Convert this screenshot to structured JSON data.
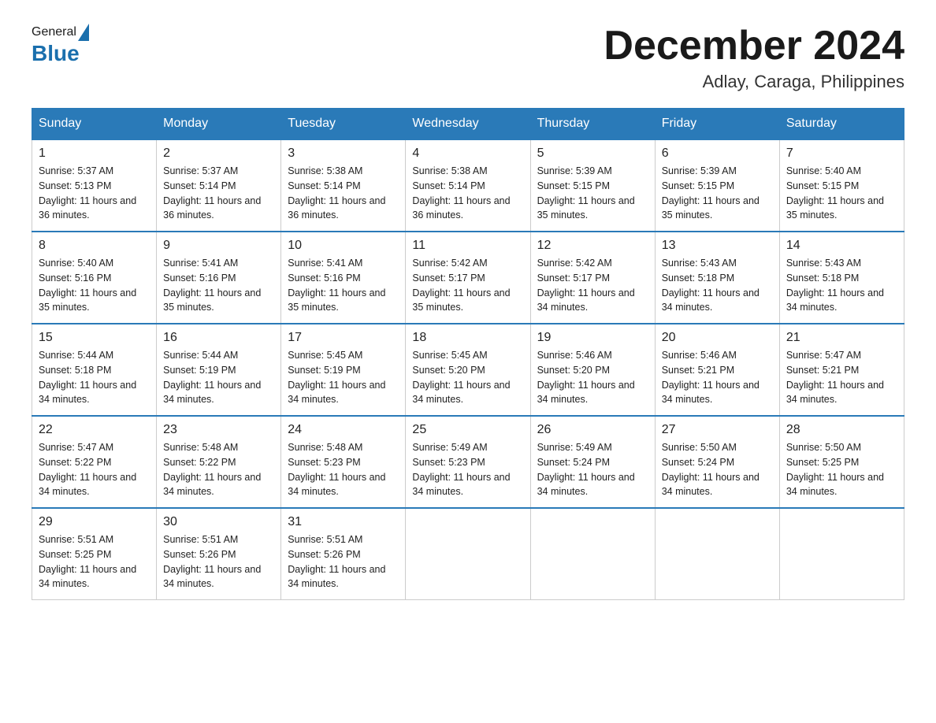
{
  "header": {
    "logo_general": "General",
    "logo_blue": "Blue",
    "month_title": "December 2024",
    "location": "Adlay, Caraga, Philippines"
  },
  "days_of_week": [
    "Sunday",
    "Monday",
    "Tuesday",
    "Wednesday",
    "Thursday",
    "Friday",
    "Saturday"
  ],
  "weeks": [
    [
      {
        "day": "1",
        "sunrise": "5:37 AM",
        "sunset": "5:13 PM",
        "daylight": "11 hours and 36 minutes."
      },
      {
        "day": "2",
        "sunrise": "5:37 AM",
        "sunset": "5:14 PM",
        "daylight": "11 hours and 36 minutes."
      },
      {
        "day": "3",
        "sunrise": "5:38 AM",
        "sunset": "5:14 PM",
        "daylight": "11 hours and 36 minutes."
      },
      {
        "day": "4",
        "sunrise": "5:38 AM",
        "sunset": "5:14 PM",
        "daylight": "11 hours and 36 minutes."
      },
      {
        "day": "5",
        "sunrise": "5:39 AM",
        "sunset": "5:15 PM",
        "daylight": "11 hours and 35 minutes."
      },
      {
        "day": "6",
        "sunrise": "5:39 AM",
        "sunset": "5:15 PM",
        "daylight": "11 hours and 35 minutes."
      },
      {
        "day": "7",
        "sunrise": "5:40 AM",
        "sunset": "5:15 PM",
        "daylight": "11 hours and 35 minutes."
      }
    ],
    [
      {
        "day": "8",
        "sunrise": "5:40 AM",
        "sunset": "5:16 PM",
        "daylight": "11 hours and 35 minutes."
      },
      {
        "day": "9",
        "sunrise": "5:41 AM",
        "sunset": "5:16 PM",
        "daylight": "11 hours and 35 minutes."
      },
      {
        "day": "10",
        "sunrise": "5:41 AM",
        "sunset": "5:16 PM",
        "daylight": "11 hours and 35 minutes."
      },
      {
        "day": "11",
        "sunrise": "5:42 AM",
        "sunset": "5:17 PM",
        "daylight": "11 hours and 35 minutes."
      },
      {
        "day": "12",
        "sunrise": "5:42 AM",
        "sunset": "5:17 PM",
        "daylight": "11 hours and 34 minutes."
      },
      {
        "day": "13",
        "sunrise": "5:43 AM",
        "sunset": "5:18 PM",
        "daylight": "11 hours and 34 minutes."
      },
      {
        "day": "14",
        "sunrise": "5:43 AM",
        "sunset": "5:18 PM",
        "daylight": "11 hours and 34 minutes."
      }
    ],
    [
      {
        "day": "15",
        "sunrise": "5:44 AM",
        "sunset": "5:18 PM",
        "daylight": "11 hours and 34 minutes."
      },
      {
        "day": "16",
        "sunrise": "5:44 AM",
        "sunset": "5:19 PM",
        "daylight": "11 hours and 34 minutes."
      },
      {
        "day": "17",
        "sunrise": "5:45 AM",
        "sunset": "5:19 PM",
        "daylight": "11 hours and 34 minutes."
      },
      {
        "day": "18",
        "sunrise": "5:45 AM",
        "sunset": "5:20 PM",
        "daylight": "11 hours and 34 minutes."
      },
      {
        "day": "19",
        "sunrise": "5:46 AM",
        "sunset": "5:20 PM",
        "daylight": "11 hours and 34 minutes."
      },
      {
        "day": "20",
        "sunrise": "5:46 AM",
        "sunset": "5:21 PM",
        "daylight": "11 hours and 34 minutes."
      },
      {
        "day": "21",
        "sunrise": "5:47 AM",
        "sunset": "5:21 PM",
        "daylight": "11 hours and 34 minutes."
      }
    ],
    [
      {
        "day": "22",
        "sunrise": "5:47 AM",
        "sunset": "5:22 PM",
        "daylight": "11 hours and 34 minutes."
      },
      {
        "day": "23",
        "sunrise": "5:48 AM",
        "sunset": "5:22 PM",
        "daylight": "11 hours and 34 minutes."
      },
      {
        "day": "24",
        "sunrise": "5:48 AM",
        "sunset": "5:23 PM",
        "daylight": "11 hours and 34 minutes."
      },
      {
        "day": "25",
        "sunrise": "5:49 AM",
        "sunset": "5:23 PM",
        "daylight": "11 hours and 34 minutes."
      },
      {
        "day": "26",
        "sunrise": "5:49 AM",
        "sunset": "5:24 PM",
        "daylight": "11 hours and 34 minutes."
      },
      {
        "day": "27",
        "sunrise": "5:50 AM",
        "sunset": "5:24 PM",
        "daylight": "11 hours and 34 minutes."
      },
      {
        "day": "28",
        "sunrise": "5:50 AM",
        "sunset": "5:25 PM",
        "daylight": "11 hours and 34 minutes."
      }
    ],
    [
      {
        "day": "29",
        "sunrise": "5:51 AM",
        "sunset": "5:25 PM",
        "daylight": "11 hours and 34 minutes."
      },
      {
        "day": "30",
        "sunrise": "5:51 AM",
        "sunset": "5:26 PM",
        "daylight": "11 hours and 34 minutes."
      },
      {
        "day": "31",
        "sunrise": "5:51 AM",
        "sunset": "5:26 PM",
        "daylight": "11 hours and 34 minutes."
      },
      null,
      null,
      null,
      null
    ]
  ],
  "labels": {
    "sunrise_prefix": "Sunrise: ",
    "sunset_prefix": "Sunset: ",
    "daylight_prefix": "Daylight: "
  }
}
